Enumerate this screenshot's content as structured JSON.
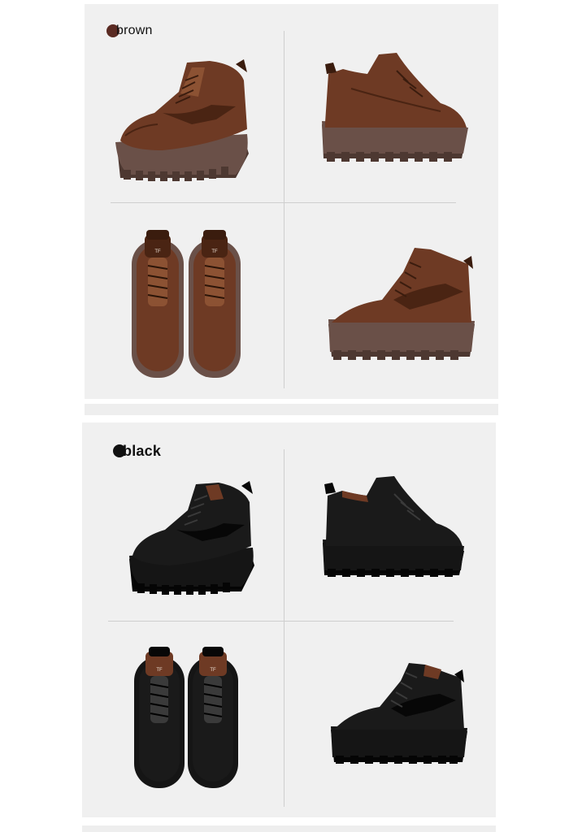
{
  "variants": [
    {
      "label": "brown",
      "swatch_color": "#5a2a22",
      "upper_color": "#6e3a24",
      "upper_dark": "#4a2413",
      "upper_light": "#8c5233",
      "sole_color": "#6a5048",
      "sole_dark": "#4d3831"
    },
    {
      "label": "black",
      "swatch_color": "#111111",
      "upper_color": "#1a1a1a",
      "upper_dark": "#070707",
      "upper_light": "#3a3a3a",
      "sole_color": "#151515",
      "sole_dark": "#050505"
    }
  ]
}
